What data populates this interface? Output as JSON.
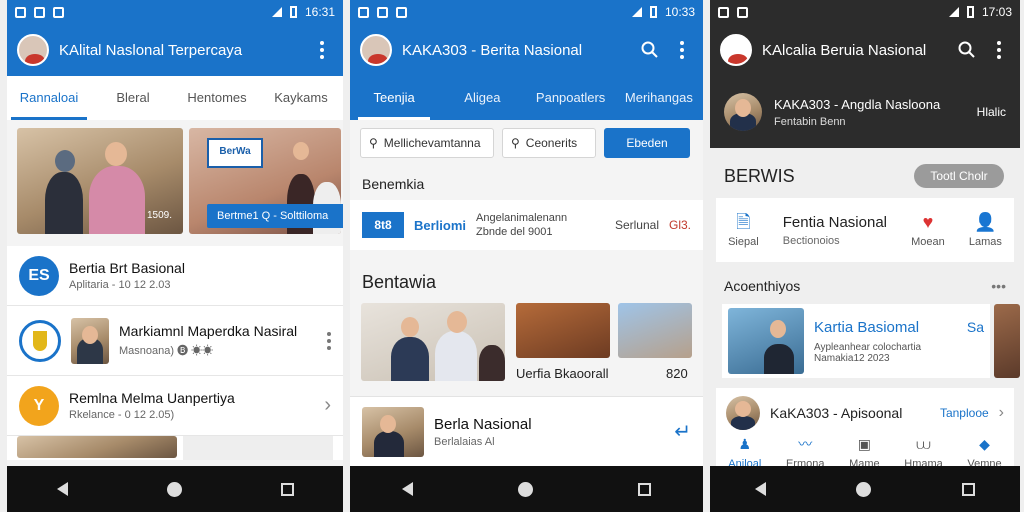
{
  "colors": {
    "brand_blue": "#1a73c9",
    "dark_header": "#2c2c2c",
    "nav_bar": "#111111"
  },
  "status": {
    "p1_time": "16:31",
    "p2_time": "10:33",
    "p3_time": "17:03"
  },
  "phone1": {
    "app_title": "KAlital Naslonal Terpercaya",
    "tabs": [
      "Rannaloai",
      "Bleral",
      "Hentomes",
      "Kaykams"
    ],
    "hero": {
      "badge": "Bertme1 Q - Solttiloma",
      "corner_text": "1509.",
      "sign_text": "BerWa"
    },
    "items": [
      {
        "title": "Bertia Brt Basional",
        "sub": "Aplitaria - 10 12 2.03",
        "icon": "ES"
      },
      {
        "title": "Markiamnl Maperdka Nasiral",
        "sub": "Masnoana) 🅑 ☀☀"
      },
      {
        "title": "Remlna Melma Uanpertiya",
        "sub": "Rkelance - 0 12 2.05)",
        "icon": "Y"
      }
    ]
  },
  "phone2": {
    "app_title": "KAKA303 - Berita Nasional",
    "tabs": [
      "Teenjia",
      "Aligea",
      "Panpoatlers",
      "Merihangas"
    ],
    "chips": {
      "first": "Mellichevamtanna",
      "second": "Ceonerits",
      "primary": "Ebeden"
    },
    "section1": "Benemkia",
    "row": {
      "logo": "8t8",
      "label": "Berliomi",
      "text1": "Angelanimalenann",
      "text2": "Zbnde del 9001",
      "right": "Serlunal",
      "right2": "Gl3."
    },
    "section2": "Bentawia",
    "caption": "Uerfia Bkaoorall",
    "caption_num": "820",
    "news": {
      "title": "Berla Nasional",
      "sub": "Berlalaias Al"
    }
  },
  "phone3": {
    "app_title": "KAlcalia Beruia Nasional",
    "profile": {
      "name": "KAKA303 - Angdla Nasloona",
      "sub": "Fentabin Benn",
      "right": "Hlalic"
    },
    "berwis": "BERWIS",
    "pill": "Tootl Cholr",
    "icons": [
      {
        "glyph": "🗎",
        "label": "Siepal"
      },
      {
        "glyph": "♥",
        "label": "Moean"
      },
      {
        "glyph": "👤",
        "label": "Lamas"
      }
    ],
    "fentia_title": "Fentia Nasional",
    "fentia_sub": "Bectionoios",
    "section": "Acoenthiyos",
    "feature": {
      "title": "Kartia Basiomal",
      "right": "Sa",
      "sub1": "Aypleanhear colochartia",
      "sub2": "Namakia12 2023"
    },
    "bottom": {
      "title": "KaKA303 - Apisoonal",
      "link": "Tanplooe"
    },
    "bottom_icons": [
      {
        "glyph": "♟",
        "label": "Anjloal"
      },
      {
        "glyph": "〰",
        "label": "Ermona"
      },
      {
        "glyph": "▣",
        "label": "Mame"
      },
      {
        "glyph": "⩊",
        "label": "Hmama"
      },
      {
        "glyph": "◆",
        "label": "Vemne"
      }
    ]
  }
}
